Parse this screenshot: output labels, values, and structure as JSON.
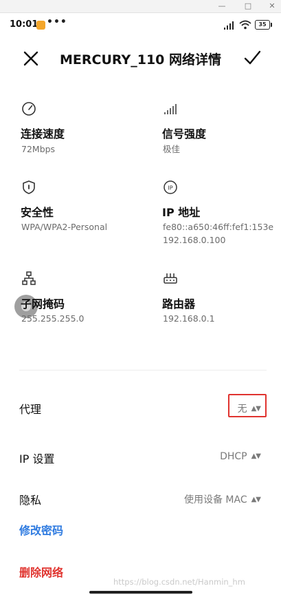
{
  "status_bar": {
    "time": "10:01",
    "dots": "•••",
    "battery": "35"
  },
  "header": {
    "title": "MERCURY_110 网络详情"
  },
  "info": {
    "speed": {
      "label": "连接速度",
      "value": "72Mbps",
      "icon": "speedometer-icon"
    },
    "signal": {
      "label": "信号强度",
      "value": "极佳",
      "icon": "signal-strength-icon"
    },
    "security": {
      "label": "安全性",
      "value": "WPA/WPA2-Personal",
      "icon": "shield-icon"
    },
    "ip": {
      "label": "IP 地址",
      "value_v6": "fe80::a650:46ff:fef1:153e",
      "value_v4": "192.168.0.100",
      "icon": "ip-location-icon"
    },
    "subnet": {
      "label": "子网掩码",
      "value": "255.255.255.0",
      "icon": "network-topology-icon"
    },
    "router": {
      "label": "路由器",
      "value": "192.168.0.1",
      "icon": "router-icon"
    }
  },
  "settings": {
    "proxy": {
      "label": "代理",
      "value": "无"
    },
    "ip_settings": {
      "label": "IP 设置",
      "value": "DHCP"
    },
    "privacy": {
      "label": "隐私",
      "value": "使用设备 MAC"
    }
  },
  "actions": {
    "change_password": "修改密码",
    "delete_network": "删除网络"
  },
  "watermark": "https://blog.csdn.net/Hanmin_hm",
  "colors": {
    "link_blue": "#2f7be0",
    "delete_red": "#e0342f",
    "highlight_box": "#e0332f"
  }
}
